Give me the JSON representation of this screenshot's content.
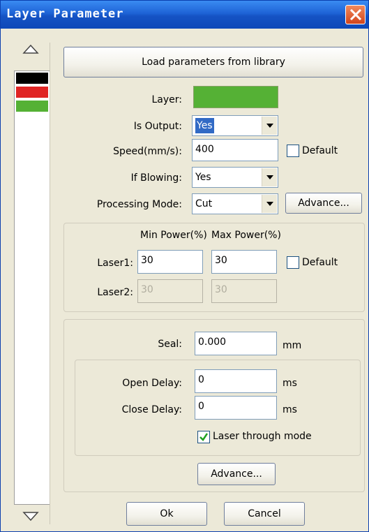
{
  "window": {
    "title": "Layer Parameter"
  },
  "layer_strip": {
    "swatches": [
      {
        "color": "#000000"
      },
      {
        "color": "#E02424"
      },
      {
        "color": "#55B135"
      }
    ]
  },
  "load_button": "Load parameters from library",
  "layer": {
    "label": "Layer:",
    "color": "#55B135"
  },
  "is_output": {
    "label": "Is Output:",
    "value": "Yes"
  },
  "speed": {
    "label": "Speed(mm/s):",
    "value": "400",
    "default_label": "Default",
    "default_checked": false
  },
  "if_blowing": {
    "label": "If Blowing:",
    "value": "Yes"
  },
  "processing_mode": {
    "label": "Processing Mode:",
    "value": "Cut",
    "advance_label": "Advance..."
  },
  "power": {
    "min_header": "Min Power(%)",
    "max_header": "Max Power(%)",
    "laser1": {
      "label": "Laser1:",
      "min": "30",
      "max": "30"
    },
    "laser2": {
      "label": "Laser2:",
      "min": "30",
      "max": "30"
    },
    "default_label": "Default",
    "default_checked": false
  },
  "seal": {
    "label": "Seal:",
    "value": "0.000",
    "unit": "mm"
  },
  "open_delay": {
    "label": "Open Delay:",
    "value": "0",
    "unit": "ms"
  },
  "close_delay": {
    "label": "Close Delay:",
    "value": "0",
    "unit": "ms"
  },
  "laser_through": {
    "label": "Laser through mode",
    "checked": true
  },
  "advance2_label": "Advance...",
  "ok_label": "Ok",
  "cancel_label": "Cancel"
}
